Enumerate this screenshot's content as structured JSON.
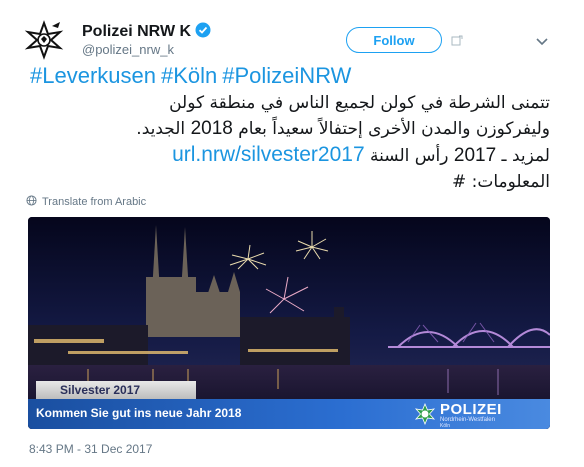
{
  "author": {
    "display_name": "Polizei NRW K",
    "handle": "@polizei_nrw_k",
    "verified": true
  },
  "follow_button": {
    "label": "Follow"
  },
  "tweet": {
    "hashtags": [
      "#Leverkusen",
      "#Köln",
      "#PolizeiNRW"
    ],
    "arabic_line1": "تتمنى الشرطة في كولن  لجميع الناس في منطقة كولن",
    "arabic_line2_a": "وليفركوزن والمدن الأخرى إحتفالاً سعيداً بعام ",
    "arabic_line2_year": "2018",
    "arabic_line2_b": " الجديد.",
    "arabic_line3_a": "لمزيد ـ ",
    "arabic_line3_year": "2017",
    "arabic_line3_b": " رأس السنة ",
    "link": "url.nrw/silvester2017",
    "arabic_line4": "المعلومات: #"
  },
  "translate": {
    "label": "Translate from Arabic"
  },
  "media": {
    "label_silvester": "Silvester 2017",
    "banner_text": "Kommen Sie gut ins neue Jahr 2018",
    "police_title": "POLIZEI",
    "police_subtitle": "Nordrhein-Westfalen",
    "police_city": "Köln"
  },
  "timestamp": "8:43 PM - 31 Dec 2017",
  "colors": {
    "link_blue": "#1b95e0",
    "follow_blue": "#1da1f2",
    "meta_gray": "#657786",
    "police_blue": "#1a4fa0"
  },
  "icons": [
    "avatar-police-star",
    "verified-badge-icon",
    "follow-add-icon",
    "chevron-down-icon",
    "globe-icon"
  ]
}
